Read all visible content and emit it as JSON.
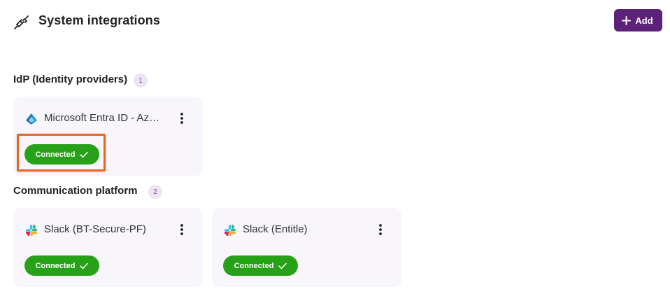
{
  "header": {
    "title": "System integrations",
    "add_label": "Add",
    "icon": "plug-icon"
  },
  "sections": [
    {
      "title": "IdP (Identity providers)",
      "count": "1",
      "cards": [
        {
          "name": "Microsoft Entra ID - Azure AD",
          "logo": "microsoft-entra-logo",
          "status": "Connected"
        }
      ]
    },
    {
      "title": "Communication platform",
      "count": "2",
      "cards": [
        {
          "name": "Slack (BT-Secure-PF)",
          "logo": "slack-logo",
          "status": "Connected"
        },
        {
          "name": "Slack (Entitle)",
          "logo": "slack-logo",
          "status": "Connected"
        }
      ]
    }
  ],
  "colors": {
    "accent": "#5c2178",
    "connected": "#27a117",
    "card_bg": "#f8f6fb",
    "badge_bg": "#ece4f3",
    "highlight": "#e8661f"
  }
}
